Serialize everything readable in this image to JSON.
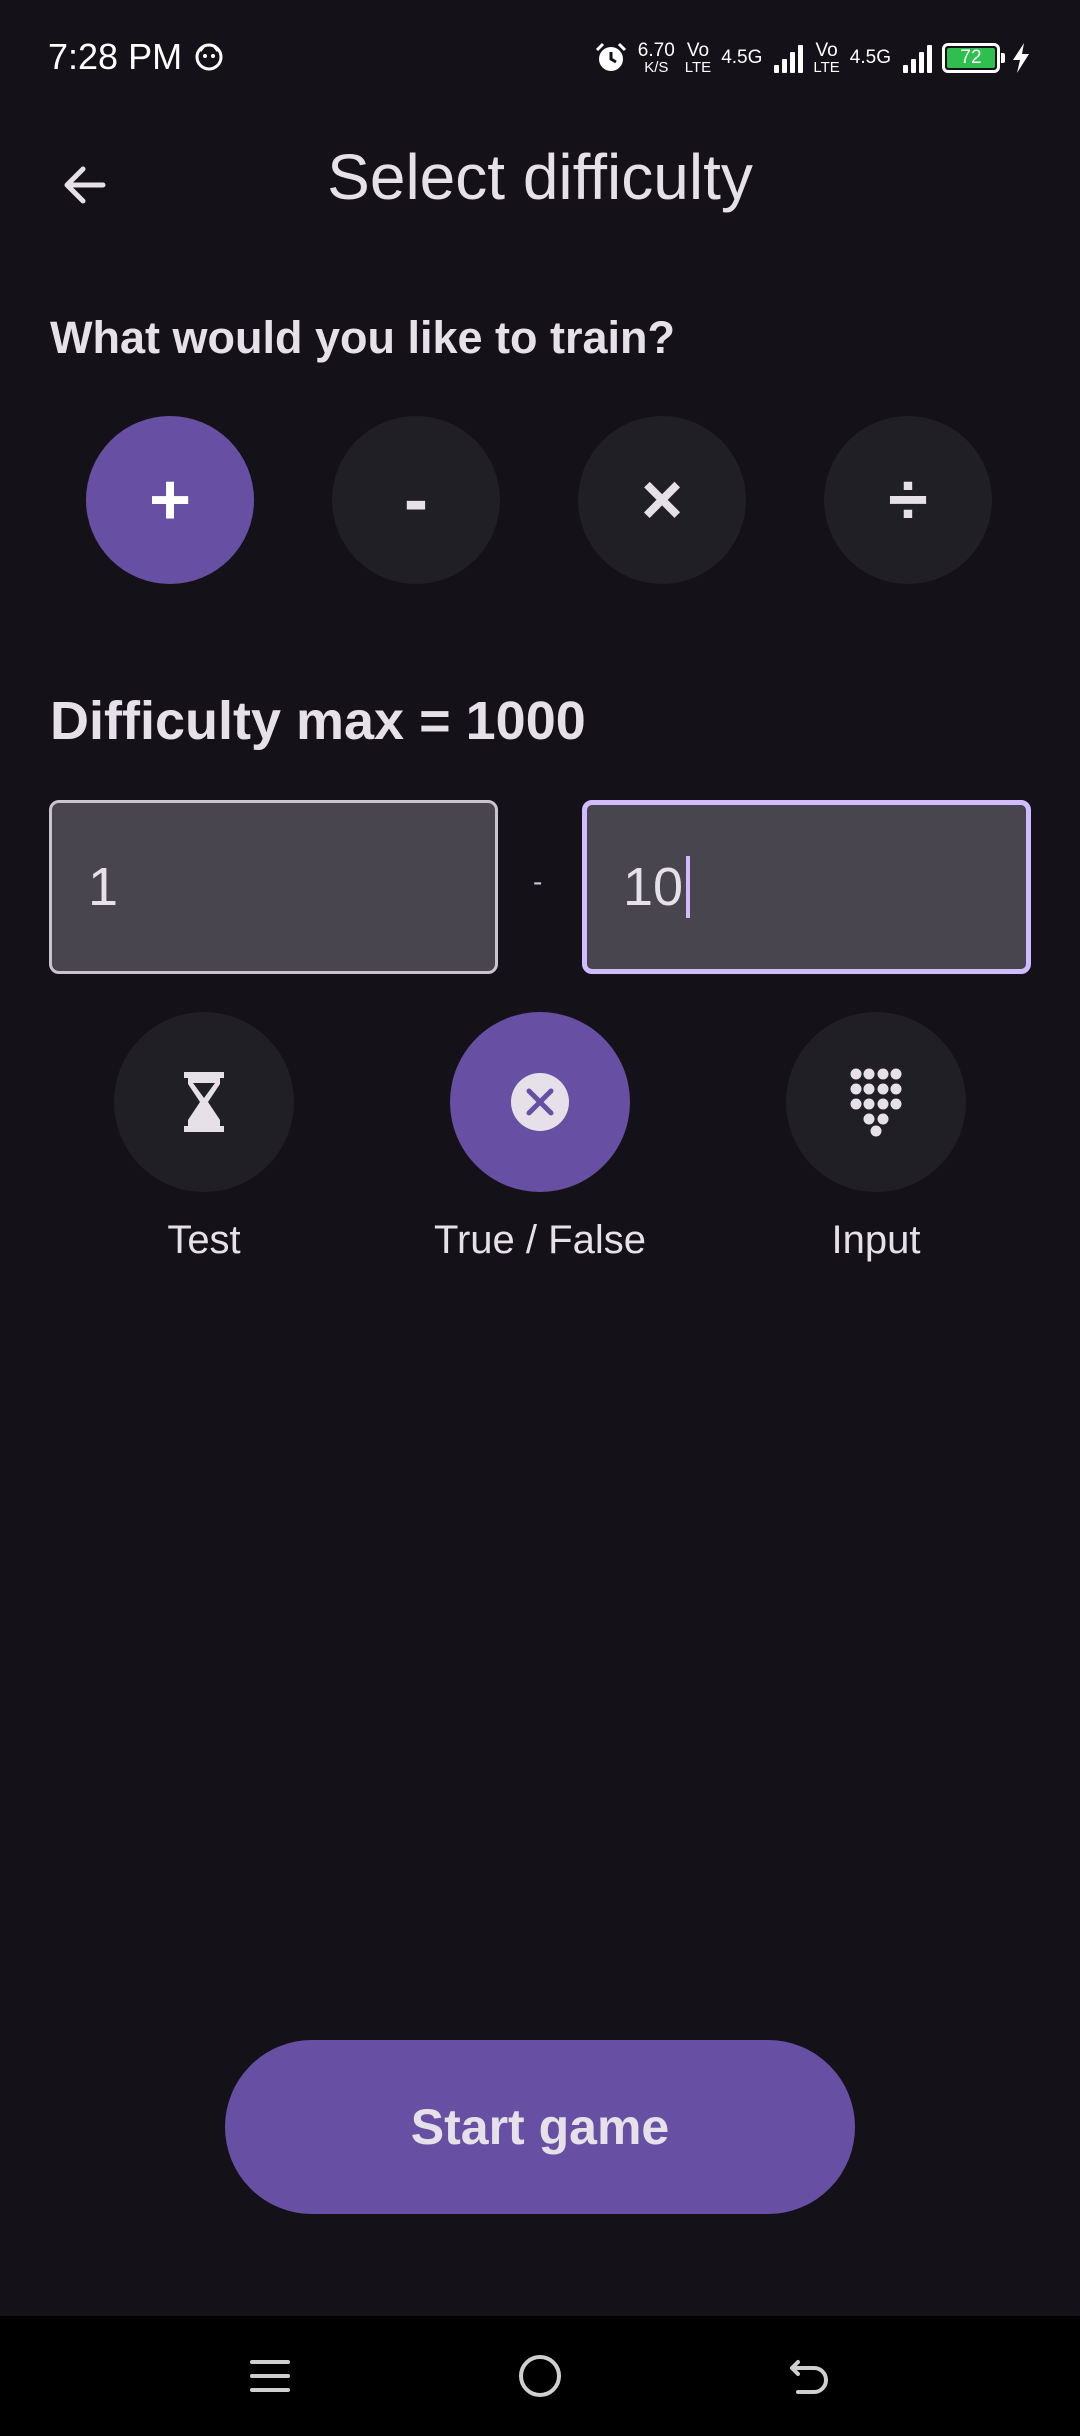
{
  "status_bar": {
    "time": "7:28 PM",
    "net_speed_value": "6.70",
    "net_speed_unit": "K/S",
    "vo_top": "Vo",
    "vo_bottom": "LTE",
    "network_type": "4.5G",
    "battery_level": "72",
    "icons": [
      "face-icon",
      "alarm-icon",
      "signal-icon",
      "battery-icon",
      "charging-bolt-icon"
    ]
  },
  "app_bar": {
    "title": "Select difficulty",
    "back_icon": "arrow-left-icon"
  },
  "train_section": {
    "heading": "What would you like to train?",
    "operations": [
      {
        "id": "add",
        "symbol": "+",
        "selected": true
      },
      {
        "id": "subtract",
        "symbol": "-",
        "selected": false
      },
      {
        "id": "multiply",
        "symbol": "×",
        "selected": false
      },
      {
        "id": "divide",
        "symbol": "÷",
        "selected": false
      }
    ]
  },
  "difficulty": {
    "heading": "Difficulty max = 1000",
    "min_value": "1",
    "max_value": "10",
    "separator": "-"
  },
  "modes": [
    {
      "label": "Test",
      "icon": "hourglass-icon",
      "selected": false
    },
    {
      "label": "True / False",
      "icon": "close-circle-icon",
      "selected": true
    },
    {
      "label": "Input",
      "icon": "dialpad-icon",
      "selected": false
    }
  ],
  "start_button": {
    "label": "Start game"
  },
  "nav_bar": {
    "icons": [
      "menu-icon",
      "home-icon",
      "back-icon"
    ]
  },
  "colors": {
    "background": "#141218",
    "accent": "#6750a4",
    "surface": "#211f26",
    "input_fill": "#49454f",
    "focus_outline": "#d0bcff",
    "text": "#e6e0e9"
  }
}
